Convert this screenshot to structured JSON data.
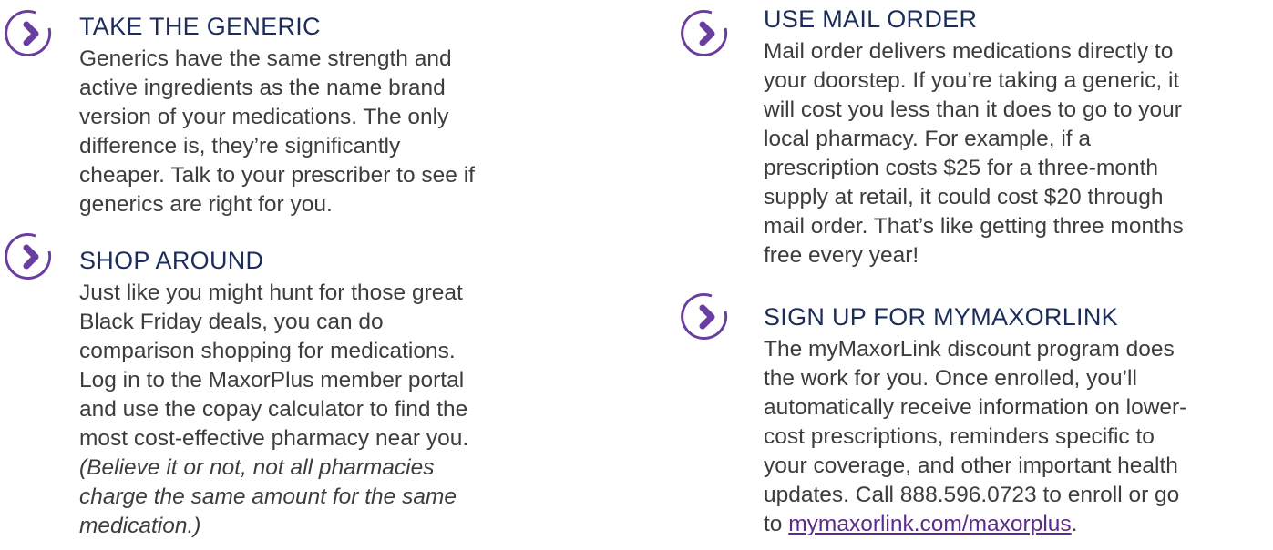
{
  "sections": [
    {
      "heading": "TAKE THE GENERIC",
      "lines": [
        "Generics have the same strength and",
        "active ingredients as the name brand",
        "version of your medications. The only",
        "difference is, they’re significantly",
        "cheaper. Talk to your prescriber to see if",
        "generics are right for you."
      ]
    },
    {
      "heading": "SHOP AROUND",
      "lines": [
        "Just like you might hunt for those great",
        "Black Friday deals, you can do",
        "comparison shopping for medications.",
        "Log in to the MaxorPlus member portal",
        "and use the copay calculator to find the",
        "most cost-effective pharmacy near you."
      ],
      "italic_lines": [
        "(Believe it or not, not all pharmacies",
        "charge the same amount for the same",
        "medication.)"
      ]
    },
    {
      "heading": "USE MAIL ORDER",
      "lines": [
        "Mail order delivers medications directly to",
        "your doorstep. If you’re taking a generic, it",
        "will cost you less than it does to go to your",
        "local pharmacy. For example, if a",
        "prescription costs $25 for a three-month",
        "supply at retail, it could cost $20 through",
        "mail order. That’s like getting three months",
        "free every year!"
      ]
    },
    {
      "heading": "SIGN UP FOR MYMAXORLINK",
      "lines": [
        "The myMaxorLink discount program does",
        "the work for you. Once enrolled, you’ll",
        "automatically receive information on lower-",
        "cost prescriptions, reminders specific to",
        "your coverage, and other important health",
        "updates. Call 888.596.0723 to enroll or go"
      ],
      "last_prefix": "to ",
      "link_text": "mymaxorlink.com/maxorplus",
      "last_suffix": "."
    }
  ],
  "icon_name": "chevron-right-circle-icon",
  "colors": {
    "heading": "#1b2d5a",
    "icon": "#6a3da0",
    "text": "#3d3d3d",
    "link": "#5b2c8c"
  }
}
